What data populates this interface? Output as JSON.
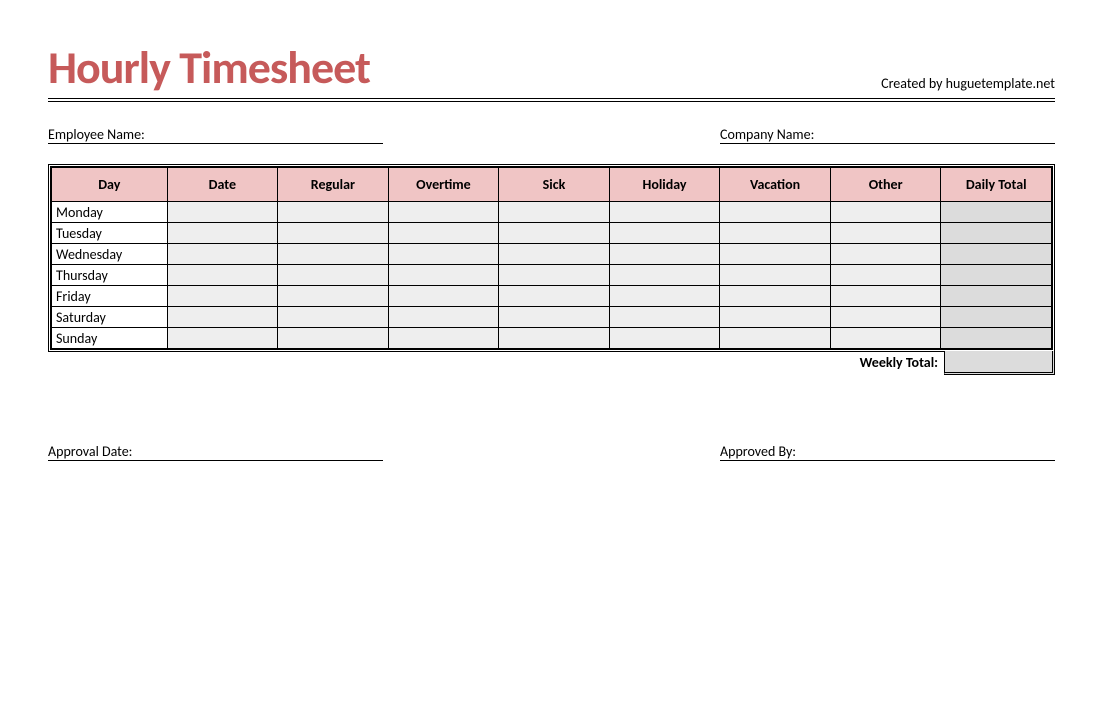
{
  "title": "Hourly Timesheet",
  "credits": "Created by huguetemplate.net",
  "fields": {
    "employee_name_label": "Employee Name:",
    "company_name_label": "Company Name:",
    "approval_date_label": "Approval Date:",
    "approved_by_label": "Approved By:"
  },
  "table": {
    "headers": [
      "Day",
      "Date",
      "Regular",
      "Overtime",
      "Sick",
      "Holiday",
      "Vacation",
      "Other",
      "Daily Total"
    ],
    "days": [
      "Monday",
      "Tuesday",
      "Wednesday",
      "Thursday",
      "Friday",
      "Saturday",
      "Sunday"
    ],
    "weekly_total_label": "Weekly Total:"
  }
}
